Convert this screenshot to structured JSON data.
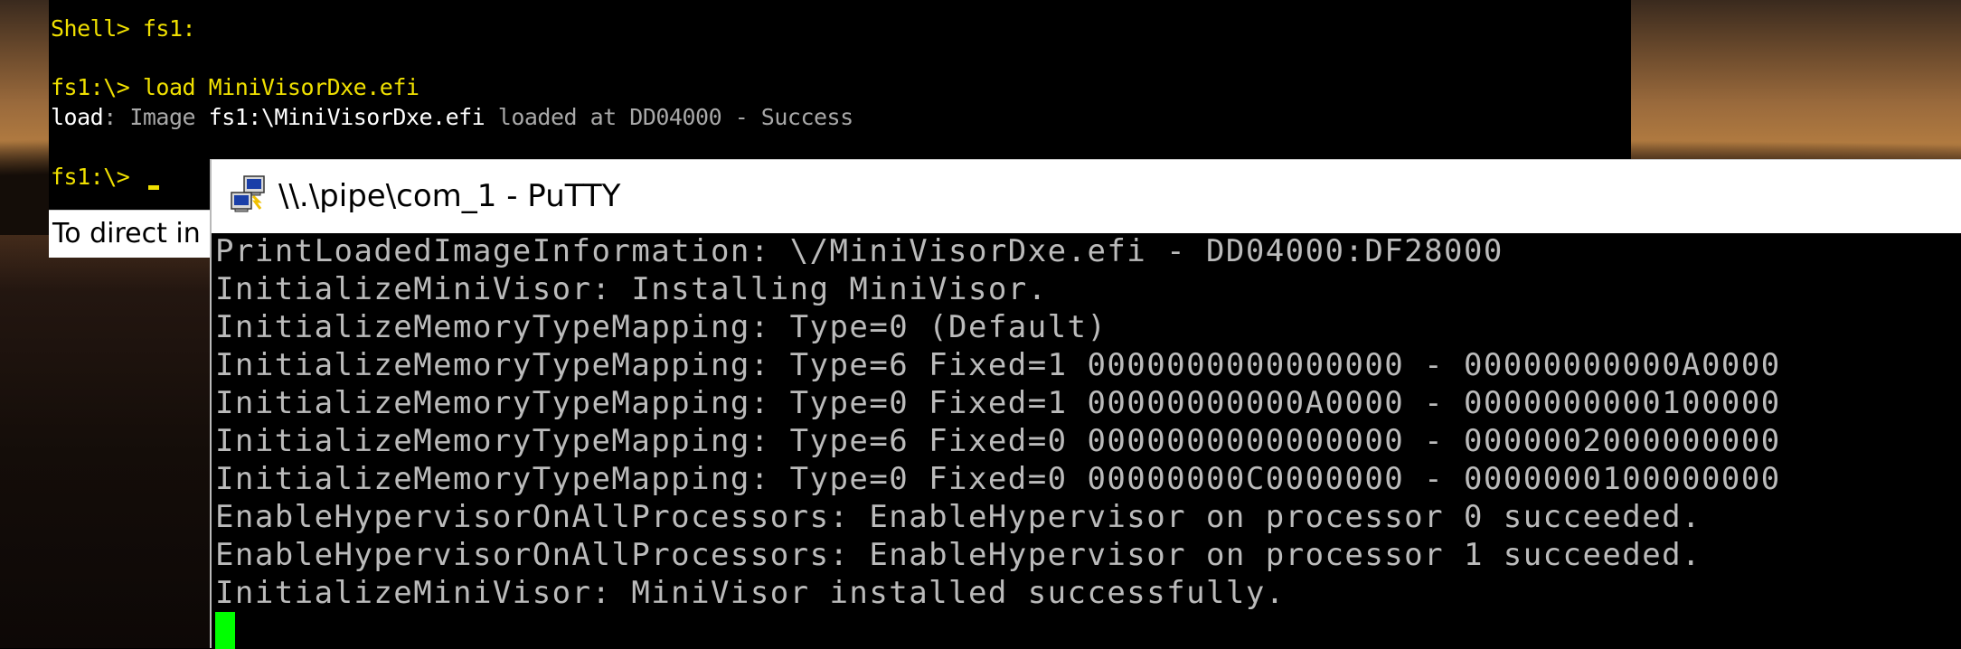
{
  "uefi_shell": {
    "lines": [
      "Shell> fs1:",
      "fs1:\\> load MiniVisorDxe.efi",
      "fs1:\\> "
    ],
    "load_result": {
      "prefix": "load",
      "sep1": ": Image ",
      "path": "fs1:\\MiniVisorDxe.efi",
      "middle": " loaded at DD04000 - Success"
    },
    "status_hint": "To direct in"
  },
  "putty": {
    "title": "\\\\.\\pipe\\com_1 - PuTTY",
    "icon": "putty-icon",
    "lines": [
      "PrintLoadedImageInformation: \\/MiniVisorDxe.efi - DD04000:DF28000",
      "InitializeMiniVisor: Installing MiniVisor.",
      "InitializeMemoryTypeMapping: Type=0 (Default)",
      "InitializeMemoryTypeMapping: Type=6 Fixed=1 0000000000000000 - 00000000000A0000",
      "InitializeMemoryTypeMapping: Type=0 Fixed=1 00000000000A0000 - 0000000000100000",
      "InitializeMemoryTypeMapping: Type=6 Fixed=0 0000000000000000 - 0000002000000000",
      "InitializeMemoryTypeMapping: Type=0 Fixed=0 00000000C0000000 - 0000000100000000",
      "EnableHypervisorOnAllProcessors: EnableHypervisor on processor 0 succeeded.",
      "EnableHypervisorOnAllProcessors: EnableHypervisor on processor 1 succeeded.",
      "InitializeMiniVisor: MiniVisor installed successfully."
    ],
    "cursor_color": "#00ff00"
  },
  "colors": {
    "uefi_prompt": "#f0e000",
    "uefi_text_gray": "#a8a8a8",
    "terminal_text": "#bbbbbb",
    "terminal_bg": "#000000"
  }
}
